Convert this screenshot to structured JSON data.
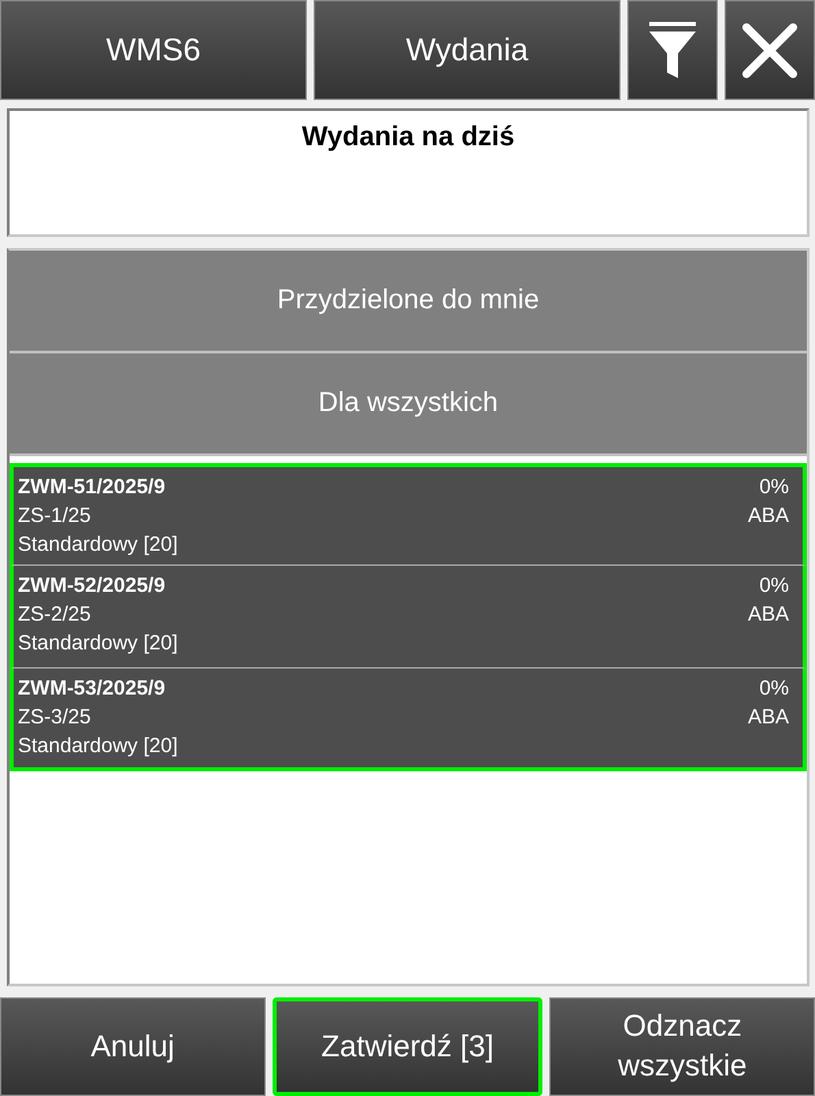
{
  "top_bar": {
    "buttons": [
      {
        "kind": "text",
        "label": "WMS6"
      },
      {
        "kind": "text",
        "label": "Wydania"
      },
      {
        "kind": "filter"
      },
      {
        "kind": "close"
      }
    ]
  },
  "header": {
    "title": "Wydania na dziś"
  },
  "categories": [
    {
      "label": "Przydzielone do mnie"
    },
    {
      "label": "Dla wszystkich"
    }
  ],
  "rows": [
    {
      "number": "ZWM-51/2025/9",
      "document": "ZS-1/25",
      "type": "Standardowy [20]",
      "progress": "0%",
      "code": "ABA",
      "selected": true
    },
    {
      "number": "ZWM-52/2025/9",
      "document": "ZS-2/25",
      "type": "Standardowy [20]",
      "progress": "0%",
      "code": "ABA",
      "selected": true
    },
    {
      "number": "ZWM-53/2025/9",
      "document": "ZS-3/25",
      "type": "Standardowy [20]",
      "progress": "0%",
      "code": "ABA",
      "selected": true
    }
  ],
  "footer": {
    "buttons": [
      {
        "label": "Anuluj",
        "focused": false
      },
      {
        "label": "Zatwierdź [3]",
        "focused": true
      },
      {
        "label": "Odznacz wszystkie",
        "focused": false
      }
    ]
  }
}
